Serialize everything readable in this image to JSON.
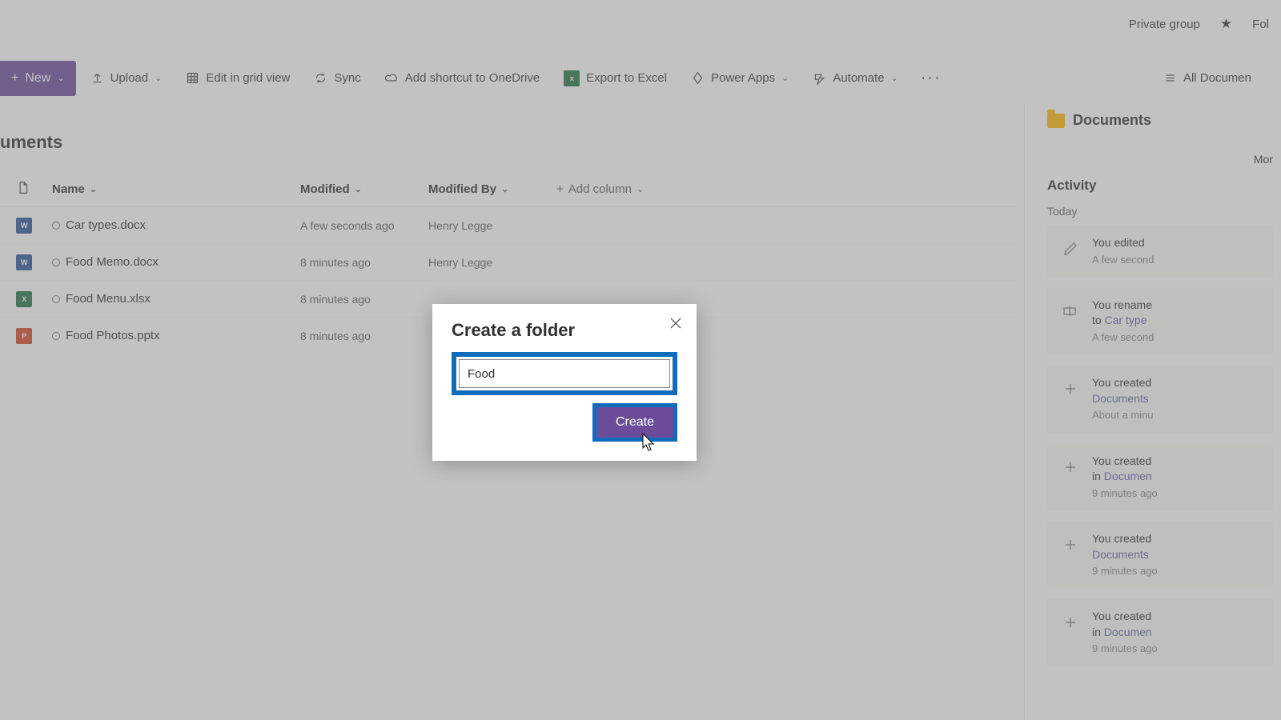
{
  "topinfo": {
    "group_label": "Private group",
    "follow_label": "Fol"
  },
  "toolbar": {
    "new": "New",
    "upload": "Upload",
    "edit_grid": "Edit in grid view",
    "sync": "Sync",
    "shortcut": "Add shortcut to OneDrive",
    "export": "Export to Excel",
    "powerapps": "Power Apps",
    "automate": "Automate",
    "all_docs": "All Documen"
  },
  "page_title": "uments",
  "columns": {
    "name": "Name",
    "modified": "Modified",
    "modified_by": "Modified By",
    "add_column": "Add column"
  },
  "files": [
    {
      "name": "Car types.docx",
      "modified": "A few seconds ago",
      "modified_by": "Henry Legge",
      "type": "word"
    },
    {
      "name": "Food Memo.docx",
      "modified": "8 minutes ago",
      "modified_by": "Henry Legge",
      "type": "word"
    },
    {
      "name": "Food Menu.xlsx",
      "modified": "8 minutes ago",
      "modified_by": "",
      "type": "excel"
    },
    {
      "name": "Food Photos.pptx",
      "modified": "8 minutes ago",
      "modified_by": "",
      "type": "ppt"
    }
  ],
  "rpanel": {
    "title": "Documents",
    "more": "Mor",
    "activity": "Activity",
    "today": "Today",
    "items": [
      {
        "icon": "pencil",
        "l1": "You edited",
        "l2": "",
        "time": "A few second"
      },
      {
        "icon": "rename",
        "l1": "You rename",
        "l2_pre": "to ",
        "l2_link": "Car type",
        "time": "A few second"
      },
      {
        "icon": "plus",
        "l1": "You created",
        "l2_link": "Documents",
        "time": "About a minu"
      },
      {
        "icon": "plus",
        "l1": "You created",
        "l2_pre": "in ",
        "l2_link": "Documen",
        "time": "9 minutes ago"
      },
      {
        "icon": "plus",
        "l1": "You created",
        "l2_link": "Documents",
        "time": "9 minutes ago"
      },
      {
        "icon": "plus",
        "l1": "You created",
        "l2_pre": "in ",
        "l2_link": "Documen",
        "time": "9 minutes ago"
      }
    ]
  },
  "dialog": {
    "title": "Create a folder",
    "value": "Food",
    "create": "Create"
  }
}
